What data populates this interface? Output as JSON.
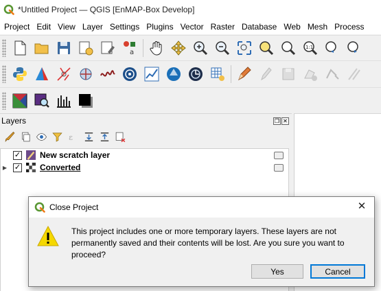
{
  "window": {
    "title": "*Untitled Project — QGIS [EnMAP-Box Develop]"
  },
  "menubar": {
    "items": [
      "Project",
      "Edit",
      "View",
      "Layer",
      "Settings",
      "Plugins",
      "Vector",
      "Raster",
      "Database",
      "Web",
      "Mesh",
      "Process"
    ]
  },
  "layers_panel": {
    "title": "Layers",
    "layers": [
      {
        "name": "New scratch layer",
        "checked": true
      },
      {
        "name": "Converted",
        "checked": true
      }
    ]
  },
  "dialog": {
    "title": "Close Project",
    "message": "This project includes one or more temporary layers. These layers are not permanently saved and their contents will be lost. Are you sure you want to proceed?",
    "yes_label": "Yes",
    "cancel_label": "Cancel",
    "close_glyph": "✕"
  },
  "colors": {
    "qgis_green": "#589632",
    "warning_yellow": "#f5d800",
    "focus_blue": "#0078d7"
  }
}
